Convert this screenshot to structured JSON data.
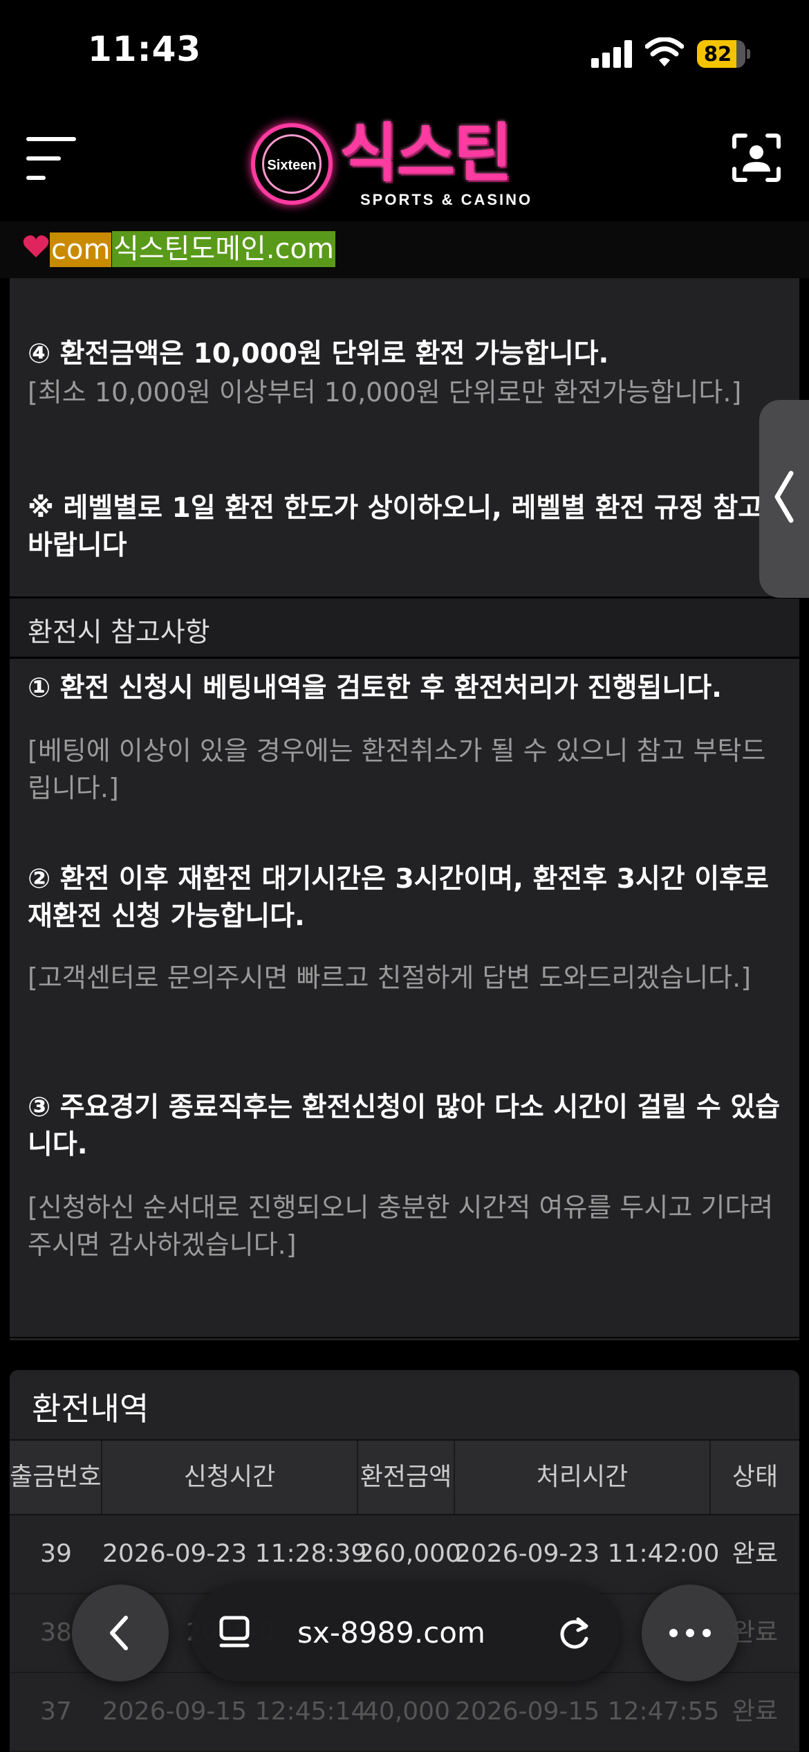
{
  "status_bar": {
    "time": "11:43",
    "battery": "82",
    "battery_level_percent": 82,
    "battery_color": "#f5c400"
  },
  "header": {
    "menu_icon": "hamburger-icon",
    "logo_en": "Sixteen",
    "logo_ko": "식스틴",
    "logo_sub": "SPORTS & CASINO",
    "brand_color": "#ff3aa0",
    "profile_icon": "scan-user-icon"
  },
  "domain_bar": {
    "com_tag": "com",
    "domain_link": "식스틴도메인.com"
  },
  "notes": {
    "rule4_bold": "④ 환전금액은 10,000원 단위로 환전 가능합니다.",
    "rule4_note": "[최소 10,000원 이상부터 10,000원 단위로만 환전가능합니다.]",
    "level_notice": "※ 레벨별로 1일 환전 한도가 상이하오니, 레벨별 환전 규정 참고바랍니다",
    "section_title": "환전시 참고사항",
    "item1_bold": "① 환전 신청시 베팅내역을 검토한 후 환전처리가 진행됩니다.",
    "item1_note": "[베팅에 이상이 있을 경우에는 환전취소가 될 수 있으니 참고 부탁드립니다.]",
    "item2_bold": "② 환전 이후 재환전 대기시간은 3시간이며, 환전후 3시간 이후로 재환전 신청 가능합니다.",
    "item2_note": "[고객센터로 문의주시면 빠르고 친절하게 답변 도와드리겠습니다.]",
    "item3_bold": "③ 주요경기 종료직후는 환전신청이 많아 다소 시간이 걸릴 수 있습니다.",
    "item3_note": "[신청하신 순서대로 진행되오니 충분한 시간적 여유를 두시고 기다려 주시면 감사하겠습니다.]"
  },
  "history": {
    "title": "환전내역",
    "columns": [
      "출금번호",
      "신청시간",
      "환전금액",
      "처리시간",
      "상태"
    ],
    "rows": [
      {
        "no": "39",
        "requested": "2026-09-23 11:28:39",
        "amount": "260,000",
        "processed": "2026-09-23 11:42:00",
        "status": "완료"
      },
      {
        "no": "38",
        "requested": "2026-0",
        "amount": "",
        "processed": "7:",
        "status": "완료"
      },
      {
        "no": "37",
        "requested": "2026-09-15 12:45:14",
        "amount": "40,000",
        "processed": "2026-09-15 12:47:55",
        "status": "완료"
      }
    ]
  },
  "browser": {
    "back_icon": "chevron-left-icon",
    "tabs_icon": "tabs-icon",
    "url": "sx-8989.com",
    "reload_icon": "reload-icon",
    "more_icon": "more-icon",
    "side_tab_icon": "chevron-left-icon"
  }
}
